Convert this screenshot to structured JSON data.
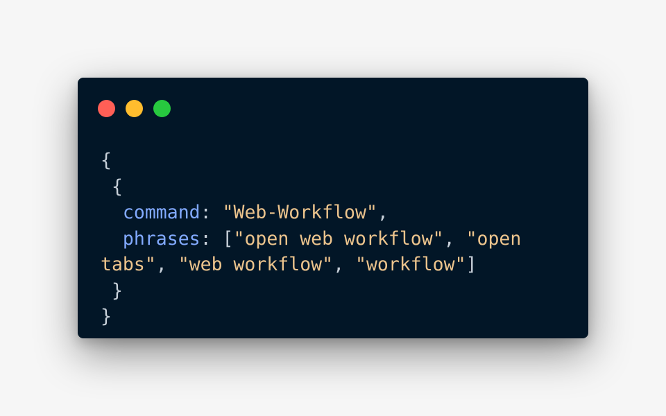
{
  "window": {
    "traffic_lights": [
      "red",
      "yellow",
      "green"
    ],
    "colors": {
      "background": "#021627",
      "red": "#ff5f56",
      "yellow": "#ffbd2e",
      "green": "#27c93f",
      "key": "#82aaff",
      "string": "#ecc48d",
      "punctuation": "#c7d0d9"
    }
  },
  "code": {
    "open_outer": "{",
    "open_inner": "{",
    "command_key": "command",
    "command_sep": ": ",
    "command_value": "\"Web-Workflow\"",
    "command_comma": ",",
    "phrases_key": "phrases",
    "phrases_sep": ": ",
    "phrases_open": "[",
    "phrase_1": "\"open web workflow\"",
    "comma_1": ", ",
    "phrase_2": "\"open tabs\"",
    "comma_2": ", ",
    "phrase_3": "\"web workflow\"",
    "comma_3": ", ",
    "phrase_4": "\"workflow\"",
    "phrases_close": "]",
    "close_inner": "}",
    "close_outer": "}"
  }
}
